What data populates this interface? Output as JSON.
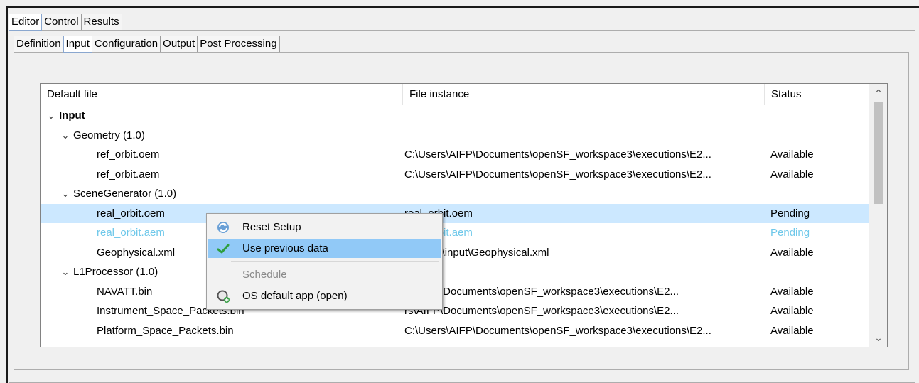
{
  "top_tabs": [
    {
      "label": "Editor",
      "active": true
    },
    {
      "label": "Control",
      "active": false
    },
    {
      "label": "Results",
      "active": false
    }
  ],
  "sub_tabs": [
    {
      "label": "Definition",
      "active": false
    },
    {
      "label": "Input",
      "active": true
    },
    {
      "label": "Configuration",
      "active": false
    },
    {
      "label": "Output",
      "active": false
    },
    {
      "label": "Post Processing",
      "active": false
    }
  ],
  "table": {
    "columns": [
      "Default file",
      "File instance",
      "Status"
    ],
    "rows": [
      {
        "name": "Input",
        "instance": "",
        "status": ""
      },
      {
        "name": "Geometry (1.0)",
        "instance": "",
        "status": ""
      },
      {
        "name": "ref_orbit.oem",
        "instance": "C:\\Users\\AIFP\\Documents\\openSF_workspace3\\executions\\E2...",
        "status": "Available"
      },
      {
        "name": "ref_orbit.aem",
        "instance": "C:\\Users\\AIFP\\Documents\\openSF_workspace3\\executions\\E2...",
        "status": "Available"
      },
      {
        "name": "SceneGenerator (1.0)",
        "instance": "",
        "status": ""
      },
      {
        "name": "real_orbit.oem",
        "instance": "real_orbit.oem",
        "status": "Pending"
      },
      {
        "name": "real_orbit.aem",
        "instance": "real_orbit.aem",
        "status": "Pending"
      },
      {
        "name": "Geophysical.xml",
        "instance": "les\\data\\input\\Geophysical.xml",
        "status": "Available"
      },
      {
        "name": "L1Processor (1.0)",
        "instance": "",
        "status": ""
      },
      {
        "name": "NAVATT.bin",
        "instance": "rs\\AIFP\\Documents\\openSF_workspace3\\executions\\E2...",
        "status": "Available"
      },
      {
        "name": "Instrument_Space_Packets.bin",
        "instance": "rs\\AIFP\\Documents\\openSF_workspace3\\executions\\E2...",
        "status": "Available"
      },
      {
        "name": "Platform_Space_Packets.bin",
        "instance": "C:\\Users\\AIFP\\Documents\\openSF_workspace3\\executions\\E2...",
        "status": "Available"
      }
    ]
  },
  "context_menu": {
    "items": [
      {
        "label": "Reset Setup",
        "icon": "refresh-icon"
      },
      {
        "label": "Use previous data",
        "icon": "checkmark-icon"
      },
      {
        "label": "Schedule",
        "icon": ""
      },
      {
        "label": "OS default app (open)",
        "icon": "open-app-icon"
      }
    ]
  },
  "scrollbar": {
    "up_glyph": "⌃",
    "down_glyph": "⌄"
  },
  "colors": {
    "selection": "#cce8ff",
    "menu_hover": "#91c9f7",
    "faded_text": "#6fc8ea"
  }
}
